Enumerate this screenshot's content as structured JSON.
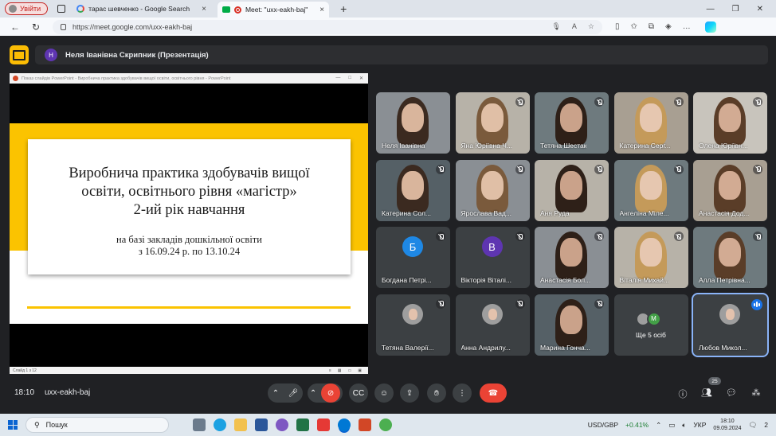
{
  "browser": {
    "profile_label": "Увійти",
    "tabs": [
      {
        "title": "тарас шевченко - Google Search",
        "active": false
      },
      {
        "title": "Meet: \"uxx-eakh-baj\"",
        "active": true
      }
    ],
    "url": "https://meet.google.com/uxx-eakh-baj"
  },
  "meet": {
    "presenter_initial": "Н",
    "presenter_label": "Неля Іванівна Скрипник (Презентація)",
    "share_window_title": "Показ слайдів PowerPoint - Виробнича практика здобувачів вищої освіти, освітнього рівня - PowerPoint",
    "slide": {
      "title_line1": "Виробнича практика здобувачів вищої",
      "title_line2": "освіти, освітнього рівня «магістр»",
      "title_line3": "2-ий рік навчання",
      "subtitle_line1": "на базі закладів дошкільної освіти",
      "subtitle_line2": "з 16.09.24 р. по 13.10.24",
      "status": "Слайд 1 з 12"
    },
    "participants": [
      {
        "name": "Неля Іванівна",
        "type": "video",
        "muted": false
      },
      {
        "name": "Яна Юріївна Ч...",
        "type": "video",
        "muted": true
      },
      {
        "name": "Тетяна Шестак",
        "type": "video",
        "muted": true
      },
      {
        "name": "Катерина Серг...",
        "type": "video",
        "muted": true
      },
      {
        "name": "Олена Юріївн...",
        "type": "video",
        "muted": true
      },
      {
        "name": "Катерина Сол...",
        "type": "video",
        "muted": true
      },
      {
        "name": "Ярослава Вад...",
        "type": "video",
        "muted": true
      },
      {
        "name": "Аня Руда",
        "type": "video",
        "muted": true
      },
      {
        "name": "Ангеліна Міле...",
        "type": "video",
        "muted": true
      },
      {
        "name": "Анастасія Дод...",
        "type": "video",
        "muted": true
      },
      {
        "name": "Богдана Петрі...",
        "type": "letter",
        "letter": "Б",
        "color": "#1e88e5",
        "muted": true
      },
      {
        "name": "Вікторія Віталі...",
        "type": "letter",
        "letter": "В",
        "color": "#5e35b1",
        "muted": true
      },
      {
        "name": "Анастасія Бол...",
        "type": "video",
        "muted": true
      },
      {
        "name": "Віталія Михай...",
        "type": "video",
        "muted": true
      },
      {
        "name": "Алла Петрівна...",
        "type": "video",
        "muted": true
      },
      {
        "name": "Тетяна Валерії...",
        "type": "photo",
        "muted": true
      },
      {
        "name": "Анна Андрилу...",
        "type": "photo",
        "muted": true
      },
      {
        "name": "Марина Гонча...",
        "type": "video",
        "muted": true
      },
      {
        "name": "Ще 5 осіб",
        "type": "more",
        "letter": "М"
      },
      {
        "name": "Любов Микол...",
        "type": "photo",
        "muted": false,
        "speaking": true
      }
    ],
    "meeting_time": "18:10",
    "meeting_code": "uxx-eakh-baj",
    "participant_count": "25"
  },
  "taskbar": {
    "search_placeholder": "Пошук",
    "currency_label": "USD/GBP",
    "currency_change": "+0.41%",
    "language": "УКР",
    "time": "18:10",
    "date": "09.09.2024",
    "notification_count": "2"
  },
  "colors": {
    "meet_bg": "#202124",
    "tile_bg": "#3c4043",
    "hangup_red": "#ea4335",
    "slide_yellow": "#fbc300",
    "speaking_blue": "#1a73e8"
  }
}
